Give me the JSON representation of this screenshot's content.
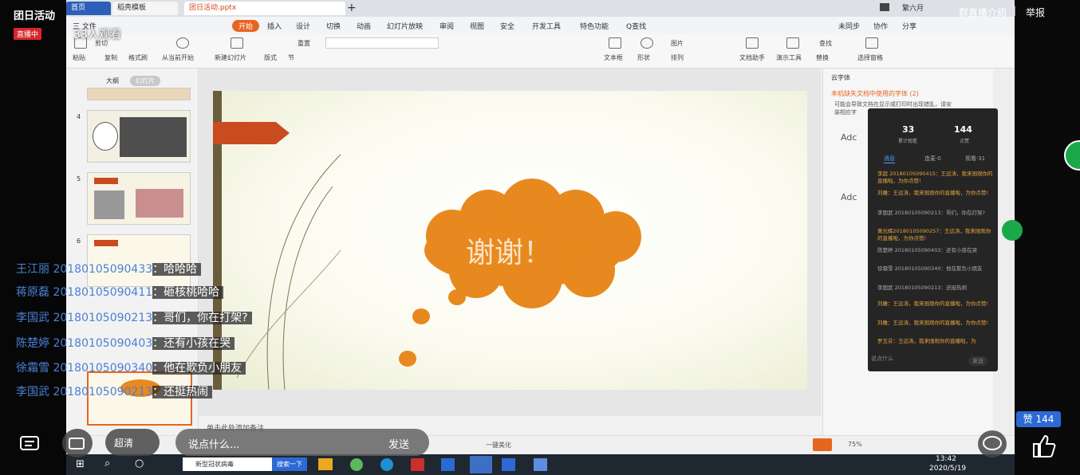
{
  "stream": {
    "title": "团日活动",
    "live_badge": "直播中",
    "viewers": "33人观看",
    "intro_link": "群直播介绍",
    "report_separator": "|",
    "report_link": "举报"
  },
  "tabs": {
    "home": "首页",
    "template": "稻壳模板",
    "file": "团日活动.pptx",
    "new_tab": "+"
  },
  "window": {
    "user_name": "繁六月"
  },
  "menu": {
    "file": "三 文件",
    "start": "开始",
    "insert": "插入",
    "design": "设计",
    "transition": "切换",
    "animation": "动画",
    "slideshow": "幻灯片放映",
    "review": "审阅",
    "view": "视图",
    "security": "安全",
    "dev": "开发工具",
    "features": "特色功能",
    "search": "Q查找",
    "sync": "未同步",
    "collab": "协作",
    "share": "分享"
  },
  "toolbar": {
    "paste": "粘贴",
    "cut": "剪切",
    "copy": "复制",
    "format_painter": "格式刷",
    "from_current": "从当前开始",
    "new_slide": "新建幻灯片",
    "layout": "版式",
    "section": "节",
    "reset": "重置",
    "textbox": "文本框",
    "shape": "形状",
    "arrange": "排列",
    "picture": "图片",
    "doc_assistant": "文档助手",
    "presenter_tool": "演示工具",
    "replace": "替换",
    "find": "查找",
    "select_pane": "选择窗格"
  },
  "slide_pane": {
    "outline_tab": "大纲",
    "slides_tab": "幻灯片",
    "thumb_numbers": [
      "4",
      "5",
      "6"
    ]
  },
  "slide": {
    "thanks_text": "谢谢！"
  },
  "notes": {
    "placeholder": "单击此处添加备注"
  },
  "statusbar": {
    "beautify": "一键美化",
    "zoom": "75%"
  },
  "font_pane": {
    "title": "云字体",
    "warning": "本机缺失文档中使用的字体 (2)",
    "desc": "可能会导致文档在显示或打印时出现错乱，请安装相应字",
    "card1_name": "Adc",
    "card2_name": "Adc"
  },
  "live_panel": {
    "watch_count": "33",
    "watch_label": "累计观看",
    "like_count": "144",
    "like_label": "点赞",
    "tab_messages": "消息",
    "tab_linkmic": "连麦·0",
    "tab_online": "观看·31",
    "messages": [
      "李超 201801050904​15：王远涛，我来围观你的直播啦，为你点赞!",
      "刘雕：王远涛，我来围观你的直播啦，为你点赞!",
      "李国武 201801050902​13：哥们，你在打架?",
      "黄光辉201801050902​57：王远涛，我来围观你的直播啦，为你点赞!",
      "陈楚婷 201801050904​03：还有小孩在哭",
      "徐霜雪 201801050903​40：他在欺负小朋友",
      "李国武 201801050902​13：还挺热闹",
      "刘雕：王远涛，我来围观你的直播啦，为你点赞!",
      "刘雕：王远涛，我来围观你的直播啦，为你点赞!",
      "罗玉芬：王远涛，我来围观你的直播啦，为"
    ],
    "input_placeholder": "说点什么",
    "send": "发送"
  },
  "chat": [
    {
      "name": "王江丽 201801050904​33",
      "sep": "：",
      "msg": "哈哈哈"
    },
    {
      "name": "蒋原磊 201801050904​11",
      "sep": "：",
      "msg": "砸核桃哈哈"
    },
    {
      "name": "李国武 201801050902​13",
      "sep": "：",
      "msg": "哥们，你在打架?"
    },
    {
      "name": "陈楚婷 201801050904​03",
      "sep": "：",
      "msg": "还有小孩在哭"
    },
    {
      "name": "徐霜雪 201801050903​40",
      "sep": "：",
      "msg": "他在欺负小朋友"
    },
    {
      "name": "李国武 201801050902​13",
      "sep": "：",
      "msg": "还挺热闹"
    }
  ],
  "controls": {
    "quality": "超清",
    "input_placeholder": "说点什么...",
    "send": "发送",
    "like_count": "赞 144"
  },
  "taskbar": {
    "search_box": "新型冠状病毒",
    "search_button": "搜索一下",
    "time": "13:42",
    "date": "2020/5/19"
  }
}
